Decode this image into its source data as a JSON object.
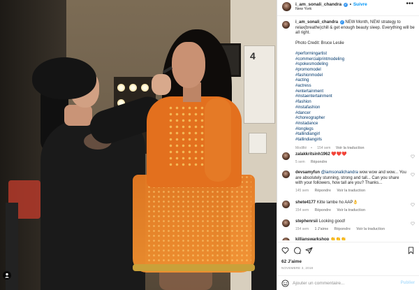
{
  "header": {
    "username": "i_am_sonali_chandra",
    "separator": "•",
    "follow_label": "Suivre",
    "location": "New York",
    "more_label": "•••"
  },
  "caption": {
    "username": "i_am_sonali_chandra",
    "text": "NEW Month, NEW strategy to relax(breathe)chill & get enough beauty sleep. Everything will be all right.",
    "credit": "Photo Credit: Bruce Leslie",
    "hashtags": [
      "#performingartist",
      "#commercialprintmodeling",
      "#spokesmodeling",
      "#promomodel",
      "#fashionmodel",
      "#acting",
      "#actress",
      "#entertainment",
      "#instaentertainment",
      "#fashion",
      "#instafashion",
      "#dancer",
      "#choreographer",
      "#instadance",
      "#longlegs",
      "#tallindiangirl",
      "#tallindiangirls"
    ],
    "edited": "Modifié",
    "time": "154 sem",
    "translate": "Voir la traduction"
  },
  "comments": [
    {
      "username": "zalakkritsinh1962",
      "text": "❤️❤️❤️",
      "time": "5 sem",
      "reply": "Répondre",
      "likes": "",
      "translate": ""
    },
    {
      "username": "devsamyfun",
      "mention": "@iamsonalichandra",
      "text": "wow wow and wow... You are absolutely stunning, strong and tall... Can you share with your followers, how tall are you? Thanks...",
      "time": "145 sem",
      "reply": "Répondre",
      "likes": "",
      "translate": "Voir la traduction"
    },
    {
      "username": "shete4177",
      "text": "Kitte lambe ho AAP👌",
      "time": "154 sem",
      "reply": "Répondre",
      "likes": "",
      "translate": "Voir la traduction"
    },
    {
      "username": "stephenrsii",
      "text": "Looking good!",
      "time": "154 sem",
      "reply": "Répondre",
      "likes": "1 J'aime",
      "translate": "Voir la traduction"
    },
    {
      "username": "killianswarkshop",
      "text": "👏👏👏",
      "time": "",
      "reply": "",
      "likes": "",
      "translate": ""
    }
  ],
  "likes_label": "62 J'aime",
  "date_label": "NOVEMBRE 3, 2018",
  "add_comment": {
    "placeholder": "Ajouter un commentaire...",
    "publish_label": "Publier"
  },
  "photo": {
    "sign_number": "4"
  },
  "icons": {
    "like": "heart-icon",
    "comment": "comment-icon",
    "share": "paper-plane-icon",
    "save": "bookmark-icon",
    "emoji": "smiley-icon",
    "verified": "verified-badge-icon",
    "more": "more-dots-icon"
  },
  "colors": {
    "link": "#00376b",
    "follow": "#0095f6",
    "muted": "#8e8e8e",
    "publish_disabled": "#b2dffc"
  }
}
